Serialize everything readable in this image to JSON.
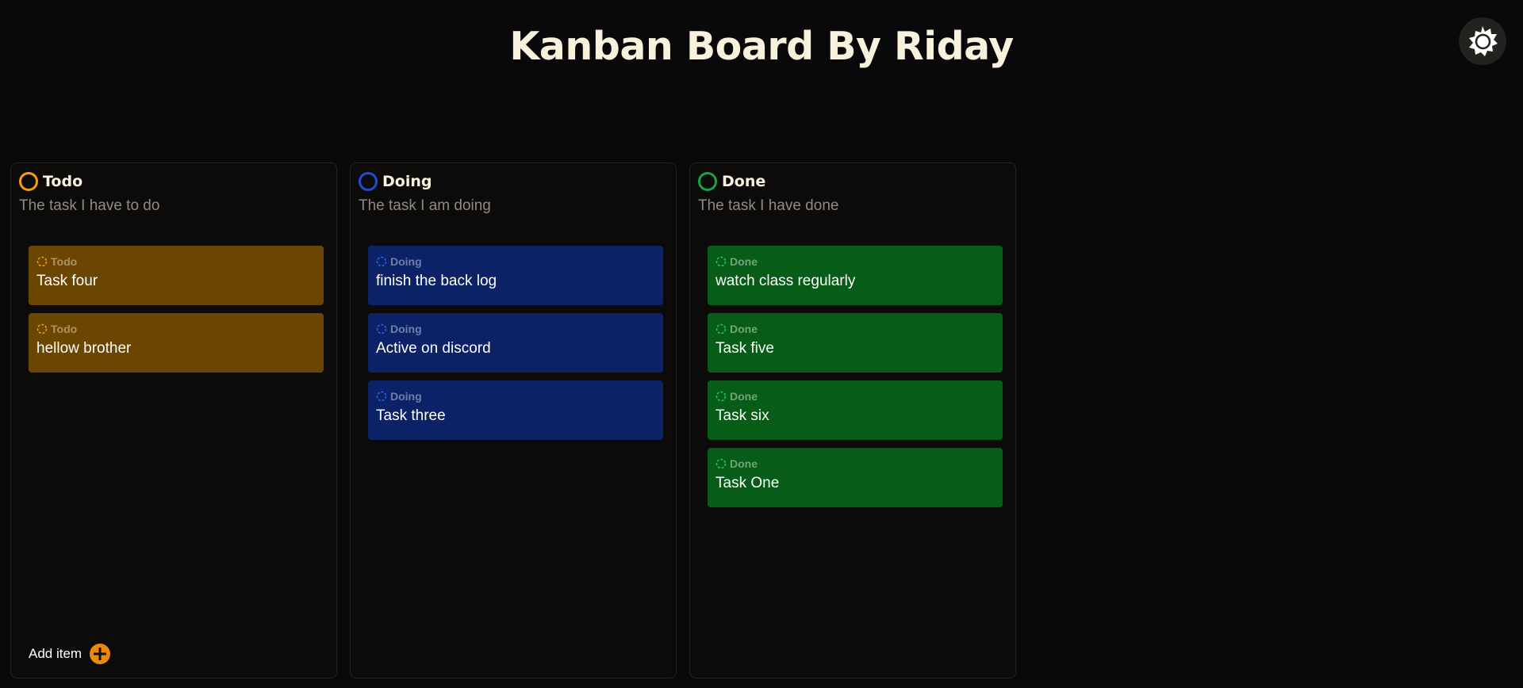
{
  "header": {
    "title": "Kanban Board By Riday"
  },
  "theme_toggle": {
    "icon": "gear-icon"
  },
  "columns": [
    {
      "key": "todo",
      "title": "Todo",
      "description": "The task I have to do",
      "color": "#f59e0b",
      "cards": [
        {
          "status": "Todo",
          "text": "Task four"
        },
        {
          "status": "Todo",
          "text": "hellow brother"
        }
      ],
      "add_item_label": "Add item"
    },
    {
      "key": "doing",
      "title": "Doing",
      "description": "The task I am doing",
      "color": "#1d4ed8",
      "cards": [
        {
          "status": "Doing",
          "text": "finish the back log"
        },
        {
          "status": "Doing",
          "text": "Active on discord"
        },
        {
          "status": "Doing",
          "text": "Task three"
        }
      ]
    },
    {
      "key": "done",
      "title": "Done",
      "description": "The task I have done",
      "color": "#16a34a",
      "cards": [
        {
          "status": "Done",
          "text": "watch class regularly"
        },
        {
          "status": "Done",
          "text": "Task five"
        },
        {
          "status": "Done",
          "text": "Task six"
        },
        {
          "status": "Done",
          "text": "Task One"
        }
      ]
    }
  ]
}
